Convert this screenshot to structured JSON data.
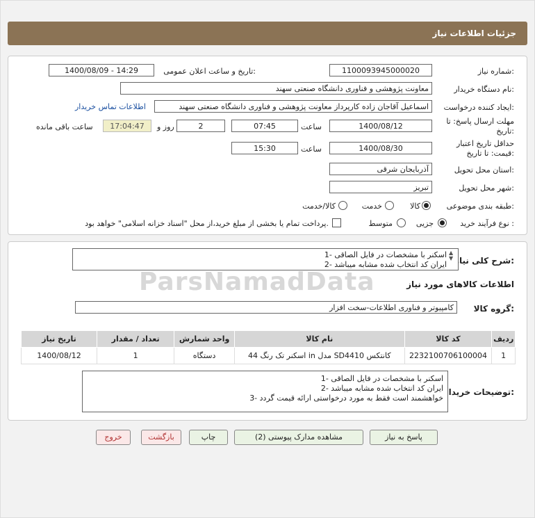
{
  "page": {
    "title": "جزئیات اطلاعات نیاز"
  },
  "form": {
    "need_number_label": "شماره نیاز:",
    "need_number": "1100093945000020",
    "announce_label": "تاریخ و ساعت اعلان عمومی:",
    "announce_value": "1400/08/09 - 14:29",
    "buyer_org_label": "نام دستگاه خریدار:",
    "buyer_org": "معاونت پژوهشی و فناوری دانشگاه صنعتی سهند",
    "requester_label": "ایجاد کننده درخواست:",
    "requester": "اسماعیل آقاجان زاده کارپرداز معاونت پژوهشی و فناوری دانشگاه صنعتی سهند",
    "contact_link": "اطلاعات تماس خریدار",
    "deadline_label_1": "مهلت ارسال پاسخ: تا",
    "deadline_label_2": "تاریخ:",
    "deadline_date": "1400/08/12",
    "time_label": "ساعت",
    "deadline_time": "07:45",
    "days_value": "2",
    "days_label": "روز و",
    "remaining_time": "17:04:47",
    "remaining_label": "ساعت باقی مانده",
    "validity_label_1": "حداقل تاریخ اعتبار",
    "validity_label_2": "قیمت: تا تاریخ:",
    "validity_date": "1400/08/30",
    "validity_time": "15:30",
    "province_label": "استان محل تحویل:",
    "province": "آذربایجان شرقی",
    "city_label": "شهر محل تحویل:",
    "city": "تبریز",
    "category_label": "طبقه بندی موضوعی:",
    "category_options": [
      "کالا",
      "خدمت",
      "کالا/خدمت"
    ],
    "process_label": "نوع فرآیند خرید :",
    "process_options": [
      "جزیی",
      "متوسط"
    ],
    "payment_note": "پرداخت تمام یا بخشی از مبلغ خرید،از محل \"اسناد خزانه اسلامی\" خواهد بود."
  },
  "summary": {
    "label": "شرح کلی نیاز:",
    "lines": [
      "1- اسکنر با مشخصات در فایل الصاقی",
      "2- ایران کد انتخاب شده مشابه میباشد"
    ]
  },
  "goods": {
    "section_title": "اطلاعات کالاهای مورد نیاز",
    "group_label": "گروه کالا:",
    "group_value": "کامپیوتر و فناوری اطلاعات-سخت افزار"
  },
  "table": {
    "headers": [
      "ردیف",
      "کد کالا",
      "نام کالا",
      "واحد شمارش",
      "تعداد / مقدار",
      "تاریخ نیاز"
    ],
    "rows": [
      [
        "1",
        "2232100706100004",
        "اسکنر تک رنگ 44 in مدل SD4410 کانتکس",
        "دستگاه",
        "1",
        "1400/08/12"
      ]
    ]
  },
  "buyer_notes": {
    "label": "توضیحات خریدار:",
    "lines": [
      "1- اسکنر با مشخصات در فایل الصاقی",
      "2- ایران کد انتخاب شده مشابه میباشد",
      "3- خواهشمند است فقط به مورد درخواستی ارائه قیمت گردد"
    ]
  },
  "watermark": "ParsNamadData",
  "buttons": {
    "reply": "پاسخ به نیاز",
    "attachments": "مشاهده مدارک پیوستی (2)",
    "print": "چاپ",
    "back": "بازگشت",
    "exit": "خروج"
  }
}
